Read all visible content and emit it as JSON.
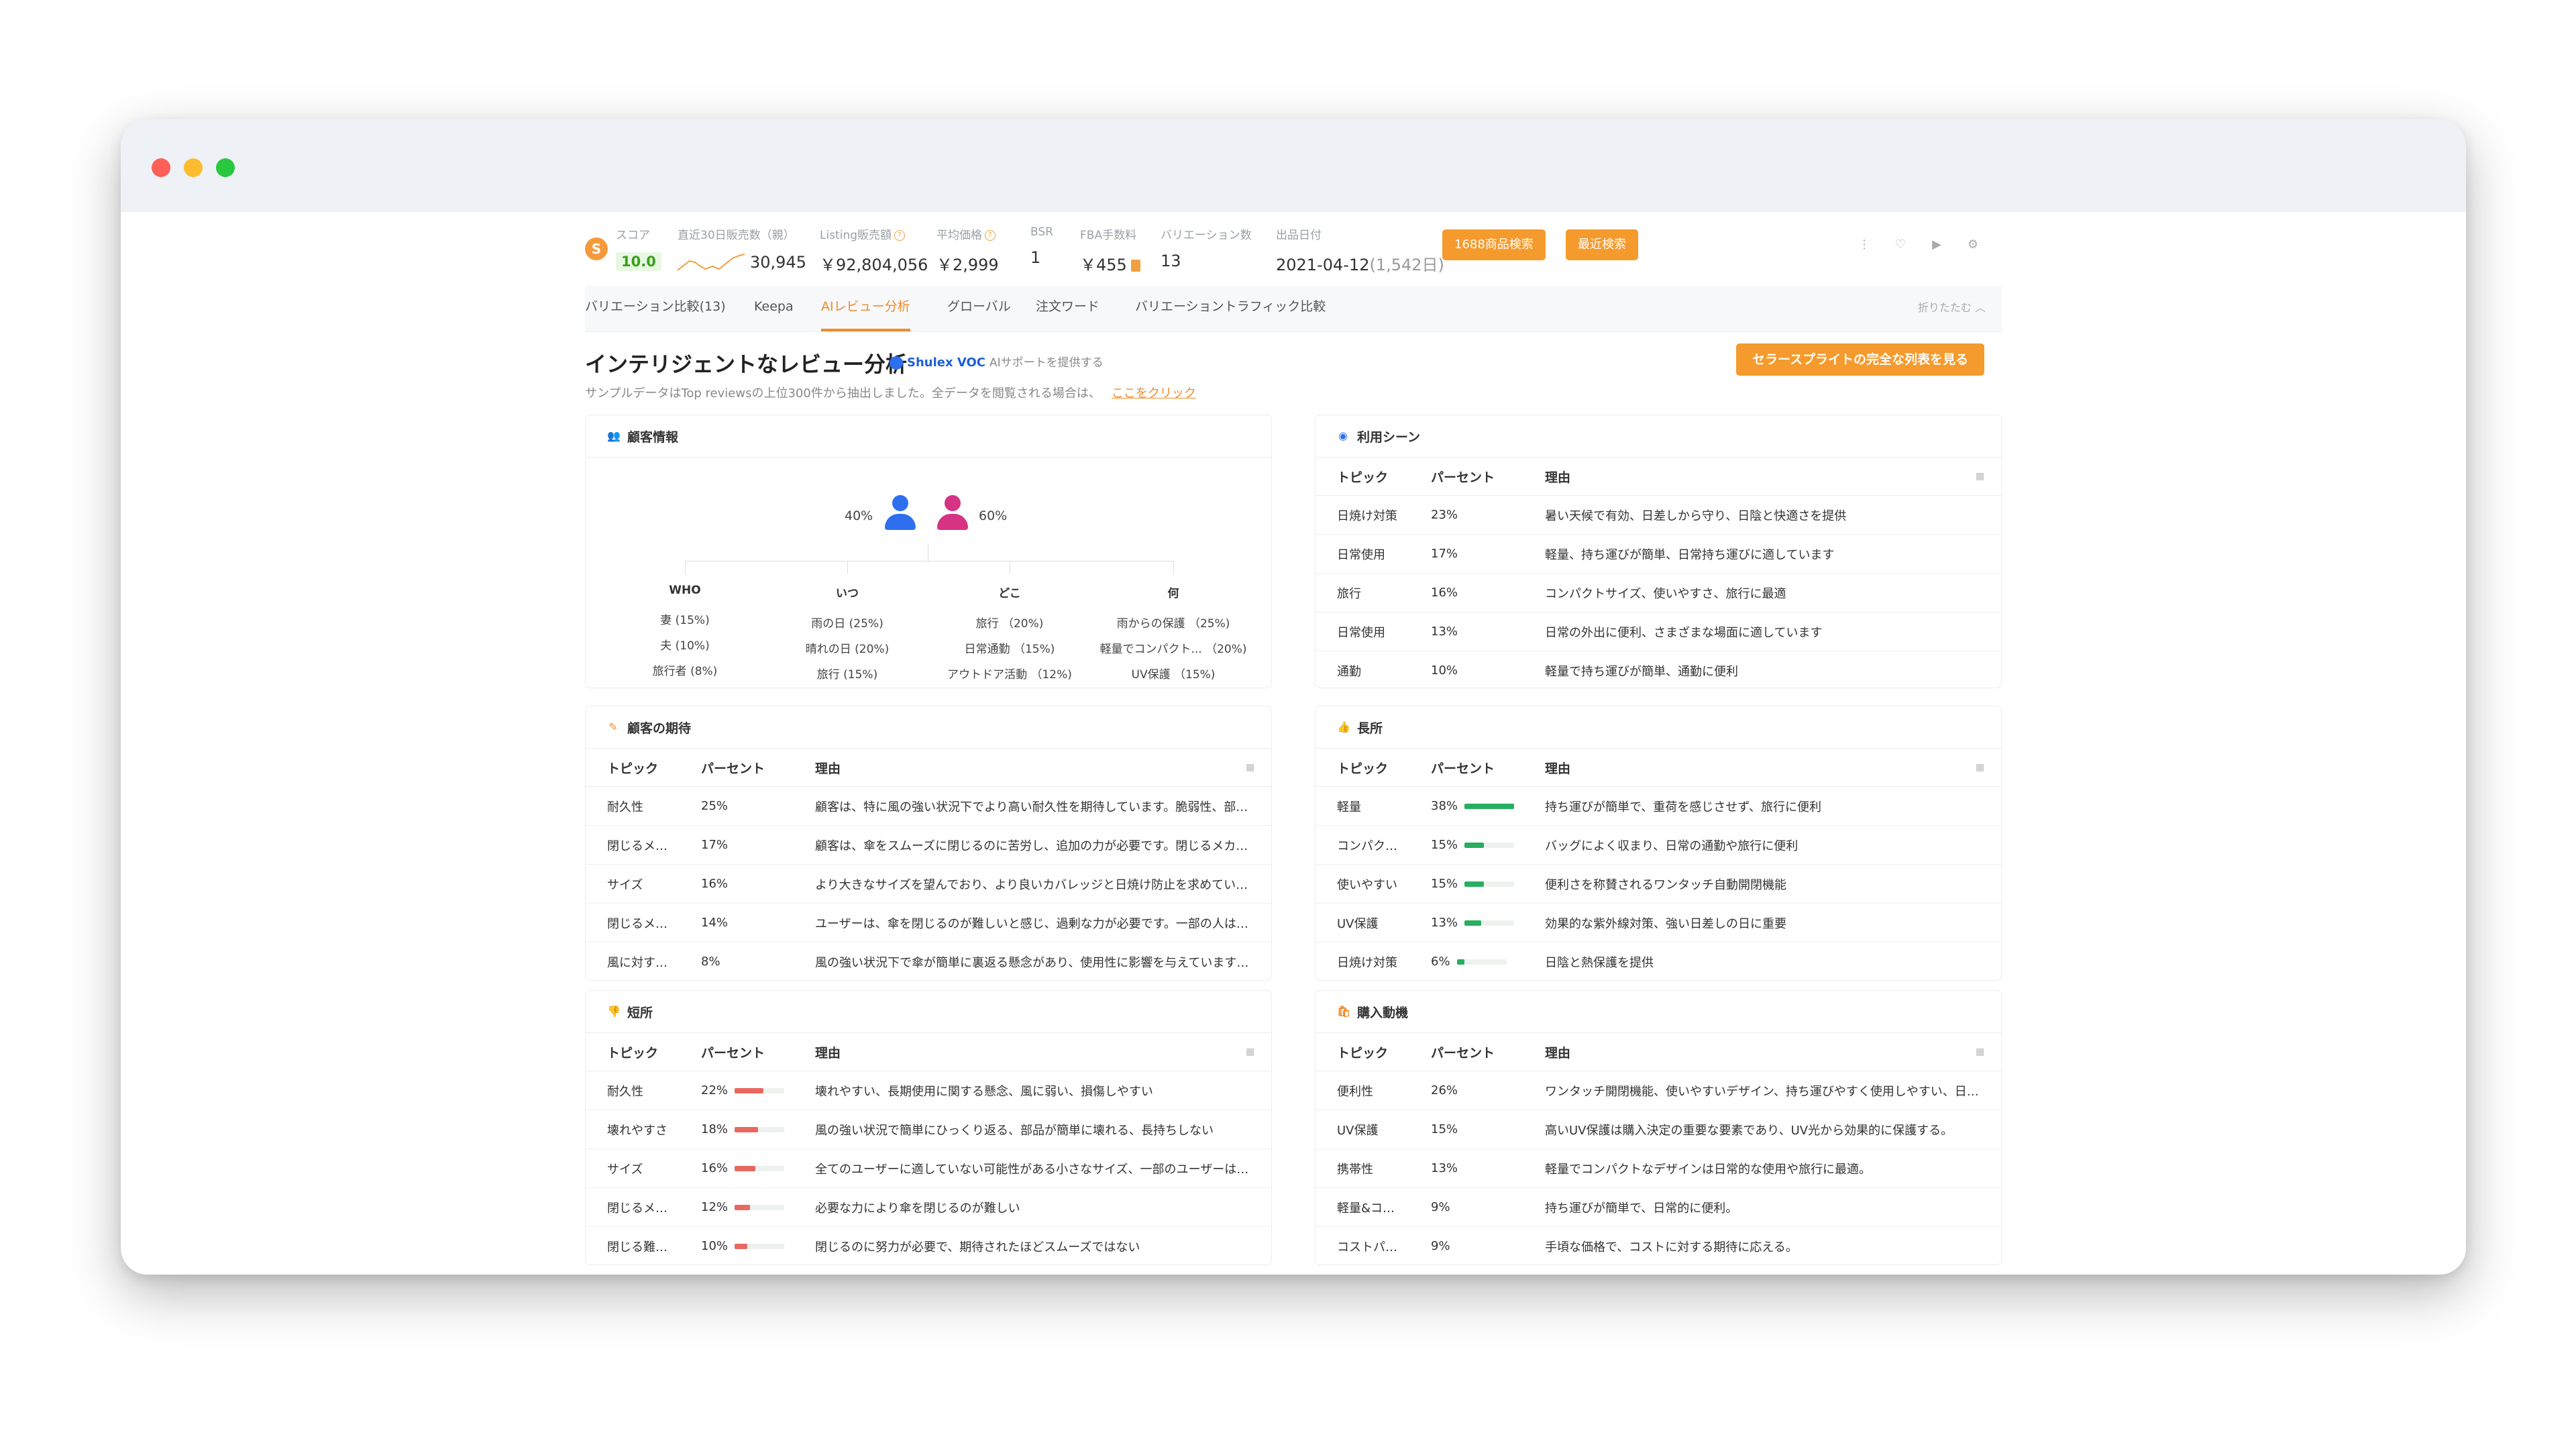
{
  "header": {
    "score_label": "スコア",
    "score_value": "10.0",
    "sales30_label": "直近30日販売数（親）",
    "sales30_value": "30,945",
    "listing_label": "Listing販売額",
    "listing_value": "￥92,804,056",
    "avg_price_label": "平均価格",
    "avg_price_value": "￥2,999",
    "bsr_label": "BSR",
    "bsr_value": "1",
    "fba_label": "FBA手数料",
    "fba_value": "￥455",
    "variation_label": "バリエーション数",
    "variation_value": "13",
    "listed_label": "出品日付",
    "listed_value": "2021-04-12",
    "listed_days": "(1,542日)",
    "btn_1688": "1688商品検索",
    "btn_recent": "最近検索"
  },
  "tabs": [
    {
      "label": "バリエーション比較(13)"
    },
    {
      "label": "Keepa"
    },
    {
      "label": "AIレビュー分析"
    },
    {
      "label": "グローバル"
    },
    {
      "label": "注文ワード"
    },
    {
      "label": "バリエーショントラフィック比較"
    }
  ],
  "collapse_label": "折りたたむ",
  "title": "インテリジェントなレビュー分析",
  "shulex_brand": "Shulex VOC",
  "shulex_desc": "AIサポートを提供する",
  "subtitle": "サンプルデータはTop reviewsの上位300件から抽出しました。全データを閲覧される場合は、",
  "subtitle_link": "ここをクリック",
  "cta_label": "セラースプライトの完全な列表を見る",
  "columns": {
    "topic": "トピック",
    "percent": "パーセント",
    "reason": "理由"
  },
  "customer_info": {
    "title": "顧客情報",
    "male_pct": "40%",
    "female_pct": "60%",
    "groups": [
      {
        "title": "WHO",
        "items": [
          "妻 (15%)",
          "夫 (10%)",
          "旅行者 (8%)"
        ]
      },
      {
        "title": "いつ",
        "items": [
          "雨の日 (25%)",
          "晴れの日 (20%)",
          "旅行 (15%)"
        ]
      },
      {
        "title": "どこ",
        "items": [
          "旅行 （20%)",
          "日常通勤 （15%)",
          "アウトドア活動 （12%)"
        ]
      },
      {
        "title": "何",
        "items": [
          "雨からの保護 （25%)",
          "軽量でコンパクト... （20%)",
          "UV保護 （15%)"
        ]
      }
    ]
  },
  "usage_scenes": {
    "title": "利用シーン",
    "rows": [
      {
        "topic": "日焼け対策",
        "percent": "23%",
        "reason": "暑い天候で有効、日差しから守り、日陰と快適さを提供"
      },
      {
        "topic": "日常使用",
        "percent": "17%",
        "reason": "軽量、持ち運びが簡単、日常持ち運びに適しています"
      },
      {
        "topic": "旅行",
        "percent": "16%",
        "reason": "コンパクトサイズ、使いやすさ、旅行に最適"
      },
      {
        "topic": "日常使用",
        "percent": "13%",
        "reason": "日常の外出に便利、さまざまな場面に適しています"
      },
      {
        "topic": "通勤",
        "percent": "10%",
        "reason": "軽量で持ち運びが簡単、通勤に便利"
      }
    ]
  },
  "expectations": {
    "title": "顧客の期待",
    "rows": [
      {
        "topic": "耐久性",
        "percent": "25%",
        "reason": "顧客は、特に風の強い状況下でより高い耐久性を期待しています。脆弱性、部…"
      },
      {
        "topic": "閉じるメ…",
        "percent": "17%",
        "reason": "顧客は、傘をスムーズに閉じるのに苦労し、追加の力が必要です。閉じるメカ…"
      },
      {
        "topic": "サイズ",
        "percent": "16%",
        "reason": "より大きなサイズを望んでおり、より良いカバレッジと日焼け防止を求めてい…"
      },
      {
        "topic": "閉じるメ…",
        "percent": "14%",
        "reason": "ユーザーは、傘を閉じるのが難しいと感じ、過剰な力が必要です。一部の人は…"
      },
      {
        "topic": "風に対す…",
        "percent": "8%",
        "reason": "風の強い状況下で傘が簡単に裏返る懸念があり、使用性に影響を与えています…"
      }
    ]
  },
  "pros": {
    "title": "長所",
    "bar_color": "#27ae60",
    "rows": [
      {
        "topic": "軽量",
        "percent": "38%",
        "value": 0.38,
        "reason": "持ち運びが簡単で、重荷を感じさせず、旅行に便利"
      },
      {
        "topic": "コンパク…",
        "percent": "15%",
        "value": 0.15,
        "reason": "バッグによく収まり、日常の通勤や旅行に便利"
      },
      {
        "topic": "使いやすい",
        "percent": "15%",
        "value": 0.15,
        "reason": "便利さを称賛されるワンタッチ自動開閉機能"
      },
      {
        "topic": "UV保護",
        "percent": "13%",
        "value": 0.13,
        "reason": "効果的な紫外線対策、強い日差しの日に重要"
      },
      {
        "topic": "日焼け対策",
        "percent": "6%",
        "value": 0.06,
        "reason": "日陰と熱保護を提供"
      }
    ]
  },
  "cons": {
    "title": "短所",
    "bar_color": "#e8685f",
    "rows": [
      {
        "topic": "耐久性",
        "percent": "22%",
        "value": 0.22,
        "reason": "壊れやすい、長期使用に関する懸念、風に弱い、損傷しやすい"
      },
      {
        "topic": "壊れやすさ",
        "percent": "18%",
        "value": 0.18,
        "reason": "風の強い状況で簡単にひっくり返る、部品が簡単に壊れる、長持ちしない"
      },
      {
        "topic": "サイズ",
        "percent": "16%",
        "value": 0.16,
        "reason": "全てのユーザーに適していない可能性がある小さなサイズ、一部のユーザーは…"
      },
      {
        "topic": "閉じるメ…",
        "percent": "12%",
        "value": 0.12,
        "reason": "必要な力により傘を閉じるのが難しい"
      },
      {
        "topic": "閉じる難…",
        "percent": "10%",
        "value": 0.1,
        "reason": "閉じるのに努力が必要で、期待されたほどスムーズではない"
      }
    ]
  },
  "purchase_motives": {
    "title": "購入動機",
    "rows": [
      {
        "topic": "便利性",
        "percent": "26%",
        "reason": "ワンタッチ開閉機能、使いやすいデザイン、持ち運びやすく使用しやすい、日…"
      },
      {
        "topic": "UV保護",
        "percent": "15%",
        "reason": "高いUV保護は購入決定の重要な要素であり、UV光から効果的に保護する。"
      },
      {
        "topic": "携帯性",
        "percent": "13%",
        "reason": "軽量でコンパクトなデザインは日常的な使用や旅行に最適。"
      },
      {
        "topic": "軽量&コ…",
        "percent": "9%",
        "reason": "持ち運びが簡単で、日常的に便利。"
      },
      {
        "topic": "コストパ…",
        "percent": "9%",
        "reason": "手頃な価格で、コストに対する期待に応える。"
      }
    ]
  }
}
